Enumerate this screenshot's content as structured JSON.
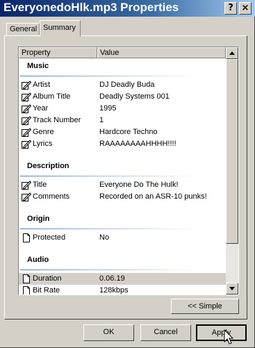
{
  "window": {
    "title": "EveryonedoHlk.mp3 Properties",
    "help_label": "?",
    "close_label": "×"
  },
  "tabs": [
    {
      "label": "General"
    },
    {
      "label": "Summary"
    }
  ],
  "list": {
    "columns": {
      "property": "Property",
      "value": "Value"
    },
    "sections": [
      {
        "title": "Music",
        "rows": [
          {
            "name": "Artist",
            "value": "DJ Deadly Buda",
            "icon": "edit-icon"
          },
          {
            "name": "Album Title",
            "value": "Deadly Systems 001",
            "icon": "edit-icon"
          },
          {
            "name": "Year",
            "value": "1995",
            "icon": "edit-icon"
          },
          {
            "name": "Track Number",
            "value": "1",
            "icon": "edit-icon"
          },
          {
            "name": "Genre",
            "value": "Hardcore Techno",
            "icon": "edit-icon"
          },
          {
            "name": "Lyrics",
            "value": "RAAAAAAAAHHHH!!!!",
            "icon": "edit-icon"
          }
        ]
      },
      {
        "title": "Description",
        "rows": [
          {
            "name": "Title",
            "value": "Everyone Do The Hulk!",
            "icon": "edit-icon"
          },
          {
            "name": "Comments",
            "value": "Recorded on an ASR-10 punks!",
            "icon": "edit-icon"
          }
        ]
      },
      {
        "title": "Origin",
        "rows": [
          {
            "name": "Protected",
            "value": "No",
            "icon": "document-icon"
          }
        ]
      },
      {
        "title": "Audio",
        "rows": [
          {
            "name": "Duration",
            "value": "0.06.19",
            "icon": "document-icon",
            "selected": true
          },
          {
            "name": "Bit Rate",
            "value": "128kbps",
            "icon": "document-icon"
          }
        ]
      }
    ]
  },
  "buttons": {
    "simple": "<< Simple",
    "ok": "OK",
    "cancel": "Cancel",
    "apply": "Apply"
  },
  "colors": {
    "title_start": "#0a246a",
    "title_end": "#a6caf0",
    "face": "#d4d0c8"
  }
}
